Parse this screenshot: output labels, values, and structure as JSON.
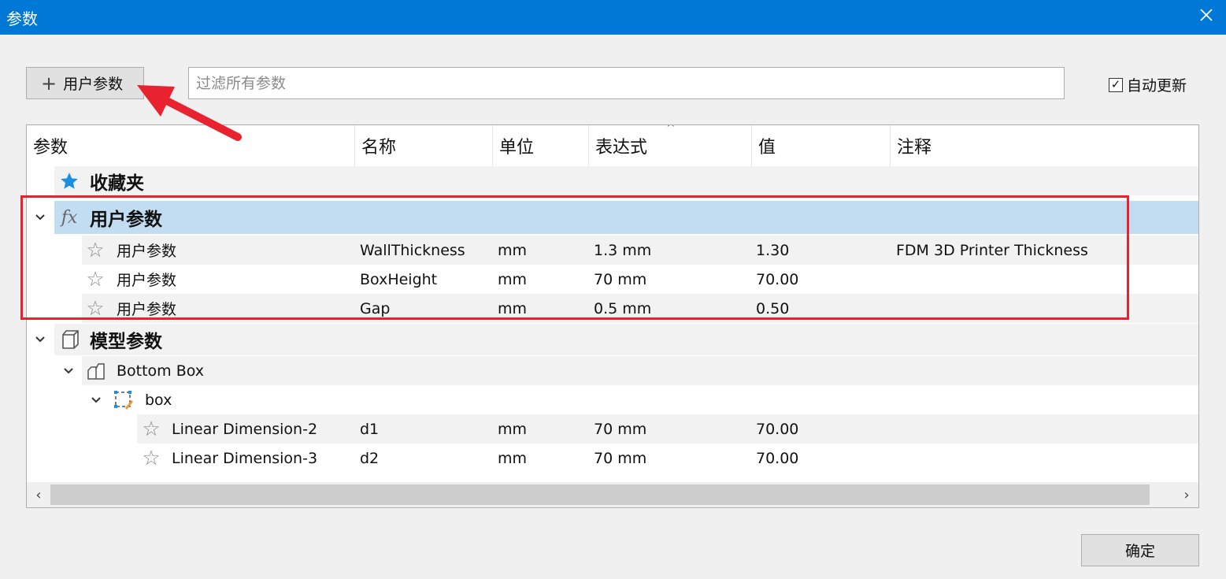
{
  "window": {
    "title": "参数"
  },
  "toolbar": {
    "add_label": "用户参数",
    "filter_placeholder": "过滤所有参数",
    "auto_update_label": "自动更新",
    "auto_update_checked": true
  },
  "columns": [
    "参数",
    "名称",
    "单位",
    "表达式",
    "值",
    "注释"
  ],
  "sorted_column": "表达式",
  "groups": {
    "favorites": {
      "label": "收藏夹",
      "icon": "star-filled-icon"
    },
    "user": {
      "label": "用户参数",
      "icon": "fx-icon",
      "expanded": true,
      "rows": [
        {
          "param": "用户参数",
          "name": "WallThickness",
          "unit": "mm",
          "expression": "1.3 mm",
          "value": "1.30",
          "comment": "FDM 3D Printer Thickness"
        },
        {
          "param": "用户参数",
          "name": "BoxHeight",
          "unit": "mm",
          "expression": "70 mm",
          "value": "70.00",
          "comment": ""
        },
        {
          "param": "用户参数",
          "name": "Gap",
          "unit": "mm",
          "expression": "0.5 mm",
          "value": "0.50",
          "comment": ""
        }
      ]
    },
    "model": {
      "label": "模型参数",
      "icon": "cube-icon",
      "expanded": true,
      "component": {
        "label": "Bottom Box",
        "icon": "component-icon"
      },
      "sketch": {
        "label": "box",
        "icon": "sketch-icon"
      },
      "rows": [
        {
          "param": "Linear Dimension-2",
          "name": "d1",
          "unit": "mm",
          "expression": "70 mm",
          "value": "70.00"
        },
        {
          "param": "Linear Dimension-3",
          "name": "d2",
          "unit": "mm",
          "expression": "70 mm",
          "value": "70.00"
        }
      ]
    }
  },
  "buttons": {
    "ok_label": "确定"
  },
  "colors": {
    "titlebar": "#0078d7",
    "selected_row": "#c2dcf2",
    "highlight": "#e8222e",
    "favorite_star": "#1a8fe0"
  }
}
